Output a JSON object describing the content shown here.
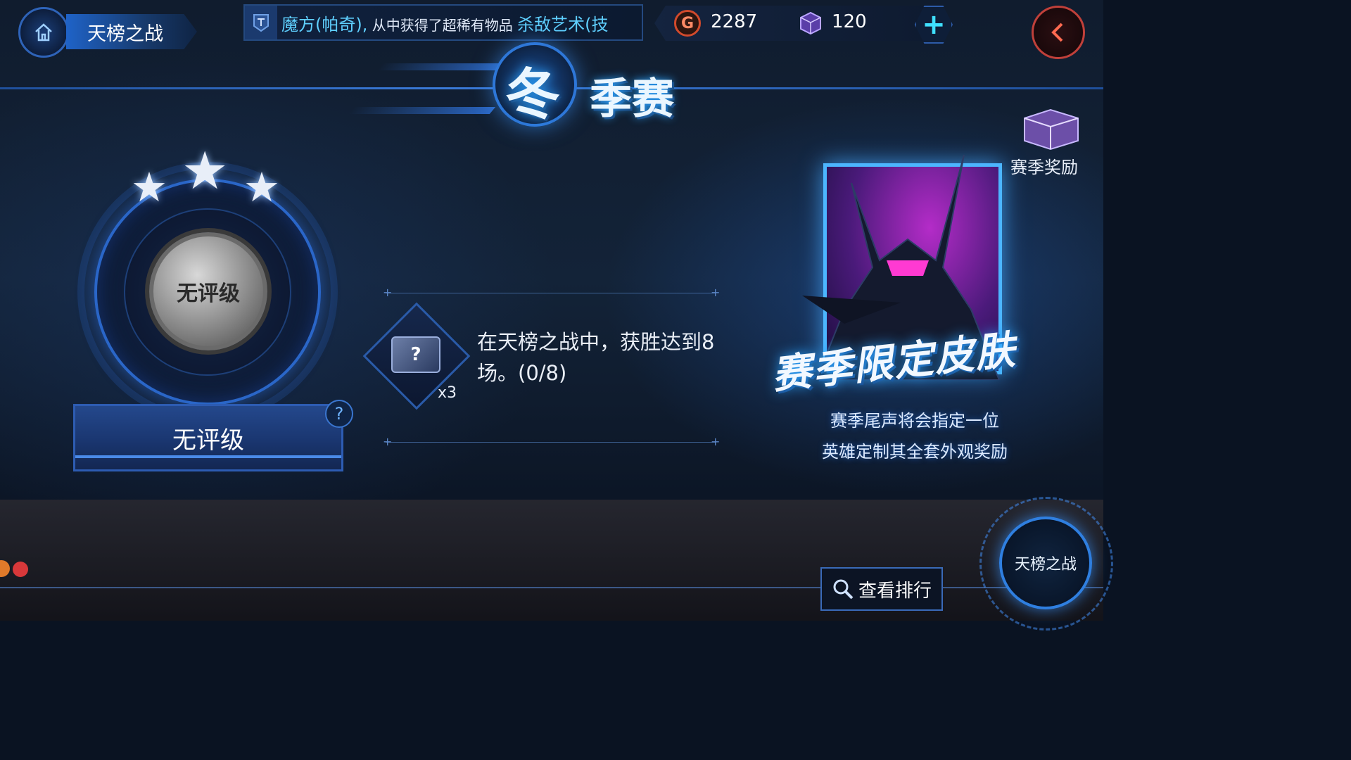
{
  "header": {
    "page_title": "天榜之战",
    "ticker_prefix": "魔方(帕奇),",
    "ticker_middle": "从中获得了超稀有物品",
    "ticker_item": "杀敌艺术(技"
  },
  "currency": {
    "gold_symbol": "G",
    "gold_value": "2287",
    "gem_value": "120",
    "add_symbol": "+"
  },
  "season": {
    "title_main": "冬",
    "title_rest": "季赛"
  },
  "rank": {
    "stars": 3,
    "medal_text": "无评级",
    "plate_text": "无评级",
    "help_symbol": "?"
  },
  "task": {
    "reward_qty": "x3",
    "reward_symbol": "?",
    "description": "在天榜之战中，获胜达到8场。(0/8)"
  },
  "promo": {
    "title": "赛季限定皮肤",
    "desc_line1": "赛季尾声将会指定一位",
    "desc_line2": "英雄定制其全套外观奖励"
  },
  "season_reward": {
    "label": "赛季奖励"
  },
  "bottom": {
    "view_rank_label": "查看排行",
    "battle_label": "天榜之战"
  },
  "colors": {
    "accent_blue": "#2e77d8",
    "back_red": "#c0403a",
    "gold_red": "#d24a2c",
    "promo_purple": "#b42cc8"
  },
  "icons": [
    "home-icon",
    "back-arrow-icon",
    "gold-coin-icon",
    "gem-cube-icon",
    "plus-icon",
    "search-icon",
    "question-icon",
    "star-icon",
    "chest-icon"
  ]
}
